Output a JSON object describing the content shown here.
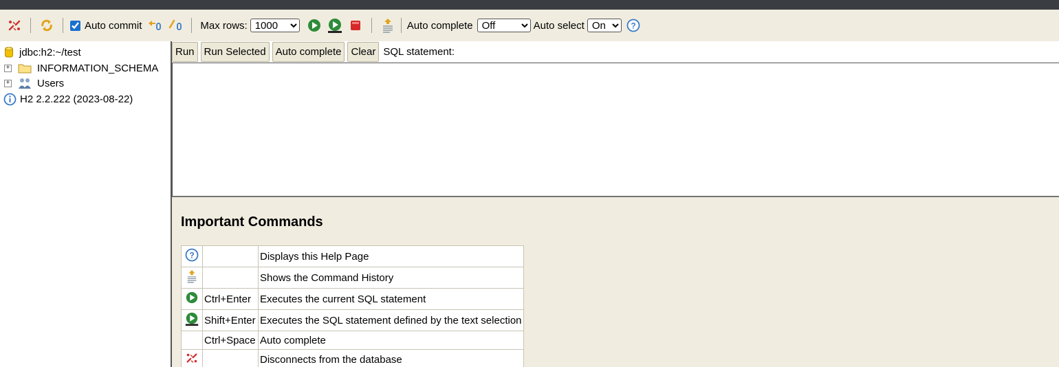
{
  "toolbar": {
    "auto_commit_label": "Auto commit",
    "max_rows_label": "Max rows:",
    "max_rows_value": "1000",
    "auto_complete_label": "Auto complete",
    "auto_complete_value": "Off",
    "auto_select_label": "Auto select",
    "auto_select_value": "On",
    "icons": [
      "disconnect-icon",
      "refresh-icon",
      "rollback-icon",
      "commit-icon",
      "run-icon",
      "run-selected-icon",
      "stop-icon",
      "history-icon",
      "help-icon"
    ]
  },
  "tree": {
    "connection": "jdbc:h2:~/test",
    "items": [
      {
        "label": "INFORMATION_SCHEMA",
        "icon": "folder-icon"
      },
      {
        "label": "Users",
        "icon": "users-icon"
      }
    ],
    "version": "H2 2.2.222 (2023-08-22)"
  },
  "query": {
    "run_label": "Run",
    "run_selected_label": "Run Selected",
    "auto_complete_label": "Auto complete",
    "clear_label": "Clear",
    "sql_statement_label": "SQL statement:"
  },
  "help": {
    "title": "Important Commands",
    "rows": [
      {
        "icon": "help-icon",
        "key": "",
        "desc": "Displays this Help Page"
      },
      {
        "icon": "history-icon",
        "key": "",
        "desc": "Shows the Command History"
      },
      {
        "icon": "run-icon",
        "key": "Ctrl+Enter",
        "desc": "Executes the current SQL statement"
      },
      {
        "icon": "run-selected-icon",
        "key": "Shift+Enter",
        "desc": "Executes the SQL statement defined by the text selection"
      },
      {
        "icon": "",
        "key": "Ctrl+Space",
        "desc": "Auto complete"
      },
      {
        "icon": "disconnect-icon",
        "key": "",
        "desc": "Disconnects from the database"
      }
    ]
  },
  "colors": {
    "panel_bg": "#f0ede0",
    "button_bg": "#ece9d8",
    "run_green": "#2e8b3a",
    "stop_red": "#d62828",
    "help_blue": "#3a7bc8",
    "disconnect_red": "#d03030"
  }
}
